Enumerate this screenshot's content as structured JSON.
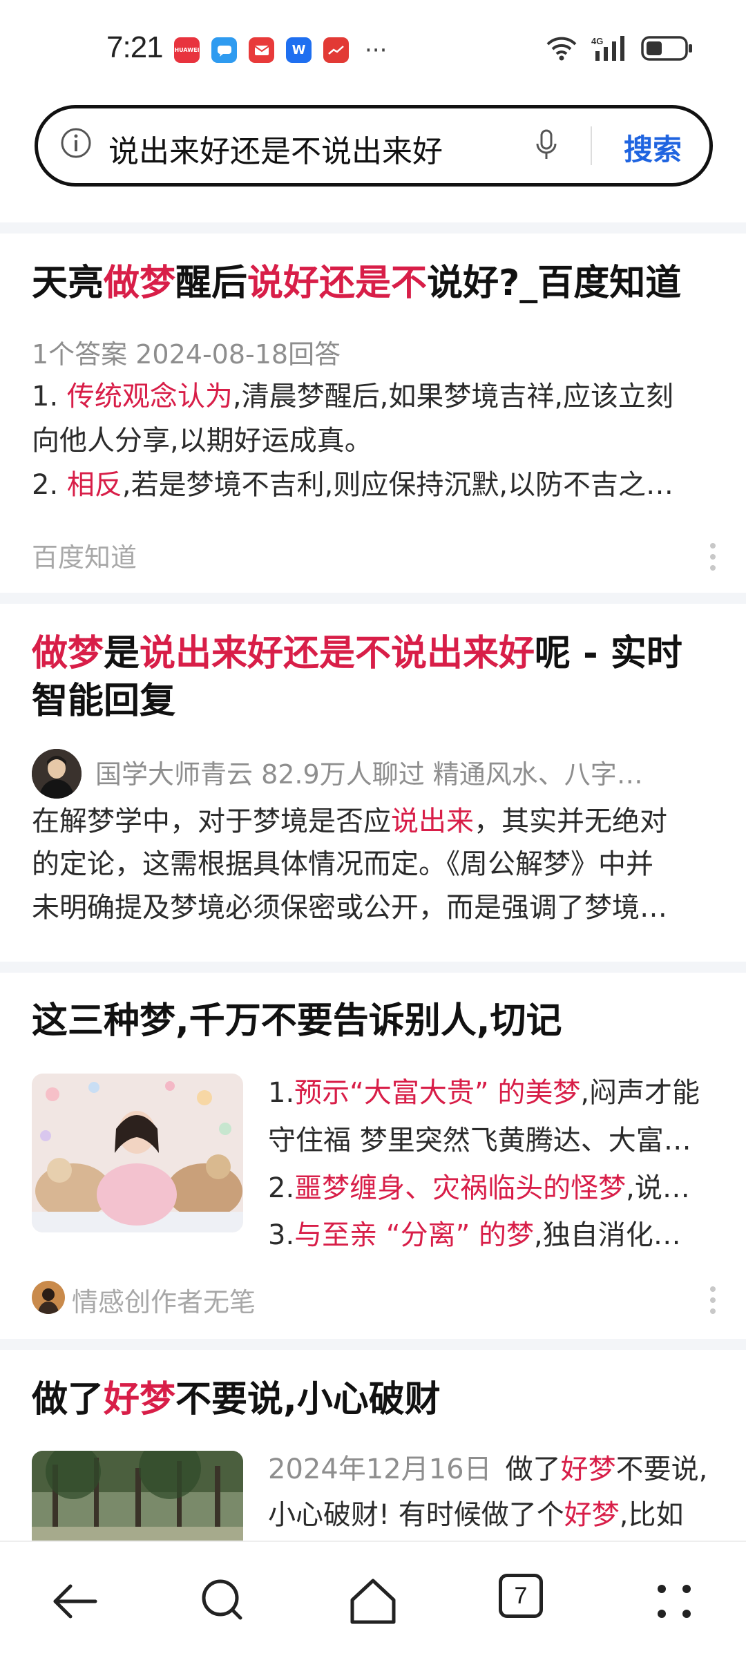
{
  "status_bar": {
    "time": "7:21",
    "apps": [
      {
        "icon": "huawei-appgallery-icon",
        "label": "HUAWEI",
        "color": "#e8333e"
      },
      {
        "icon": "chat-app-icon",
        "label": "",
        "color": "#2f9bf0"
      },
      {
        "icon": "mail-app-icon",
        "label": "",
        "color": "#e83a3a"
      },
      {
        "icon": "weibo-w-app-icon",
        "label": "W",
        "color": "#1f6ff0"
      },
      {
        "icon": "stock-app-icon",
        "label": "",
        "color": "#e23a35"
      }
    ],
    "more": "···"
  },
  "search": {
    "query": "说出来好还是不说出来好",
    "button": "搜索"
  },
  "results": [
    {
      "title_parts": [
        {
          "t": "天亮",
          "hl": false
        },
        {
          "t": "做梦",
          "hl": true
        },
        {
          "t": "醒后",
          "hl": false
        },
        {
          "t": "说好还是不",
          "hl": true
        },
        {
          "t": "说好?_百度知道",
          "hl": false
        }
      ],
      "meta": "1个答案  2024-08-18回答",
      "lines": [
        [
          {
            "t": "1. ",
            "hl": false
          },
          {
            "t": "传统观念认为",
            "hl": true
          },
          {
            "t": ",清晨梦醒后,如果梦境吉祥,应该立刻",
            "hl": false
          }
        ],
        [
          {
            "t": "向他人分享,以期好运成真。",
            "hl": false
          }
        ],
        [
          {
            "t": "2. ",
            "hl": false
          },
          {
            "t": "相反",
            "hl": true
          },
          {
            "t": ",若是梦境不吉利,则应保持沉默,以防不吉之…",
            "hl": false
          }
        ]
      ],
      "source": "百度知道"
    },
    {
      "title_line1": [
        {
          "t": "做梦",
          "hl": true
        },
        {
          "t": "是",
          "hl": false
        },
        {
          "t": "说出来好还是不说出来好",
          "hl": true
        },
        {
          "t": "呢 - 实时",
          "hl": false
        }
      ],
      "title_line2": [
        {
          "t": "智能回复",
          "hl": false
        }
      ],
      "author": "国学大师青云  82.9万人聊过  精通风水、八字…",
      "lines": [
        [
          {
            "t": "在解梦学中，对于梦境是否应",
            "hl": false
          },
          {
            "t": "说出来",
            "hl": true
          },
          {
            "t": "，其实并无绝对",
            "hl": false
          }
        ],
        [
          {
            "t": "的定论，这需根据具体情况而定。《周公解梦》中并",
            "hl": false
          }
        ],
        [
          {
            "t": "未明确提及梦境必须保密或公开，而是强调了梦境…",
            "hl": false
          }
        ]
      ]
    },
    {
      "title": "这三种梦,千万不要告诉别人,切记",
      "lines": [
        [
          {
            "t": "1.",
            "hl": false
          },
          {
            "t": "预示“大富大贵” 的美梦",
            "hl": true
          },
          {
            "t": ",闷声才能",
            "hl": false
          }
        ],
        [
          {
            "t": "守住福 梦里突然飞黄腾达、大富…",
            "hl": false
          }
        ],
        [
          {
            "t": "2.",
            "hl": false
          },
          {
            "t": "噩梦缠身、灾祸临头的怪梦",
            "hl": true
          },
          {
            "t": ",说…",
            "hl": false
          }
        ],
        [
          {
            "t": "3.",
            "hl": false
          },
          {
            "t": "与至亲 “分离” 的梦",
            "hl": true
          },
          {
            "t": ",独自消化…",
            "hl": false
          }
        ]
      ],
      "source": "情感创作者无笔"
    },
    {
      "title_parts": [
        {
          "t": "做了",
          "hl": false
        },
        {
          "t": "好梦",
          "hl": true
        },
        {
          "t": "不要说,小心破财",
          "hl": false
        }
      ],
      "date": "2024年12月16日",
      "lines": [
        [
          {
            "t": "做了",
            "hl": false
          },
          {
            "t": "好梦",
            "hl": true
          },
          {
            "t": "不要说,",
            "hl": false
          }
        ],
        [
          {
            "t": "小心破财! 有时候做了个",
            "hl": false
          },
          {
            "t": "好梦",
            "hl": true
          },
          {
            "t": ",比如",
            "hl": false
          }
        ]
      ]
    }
  ],
  "bottom_nav": {
    "tab_count": "7"
  }
}
